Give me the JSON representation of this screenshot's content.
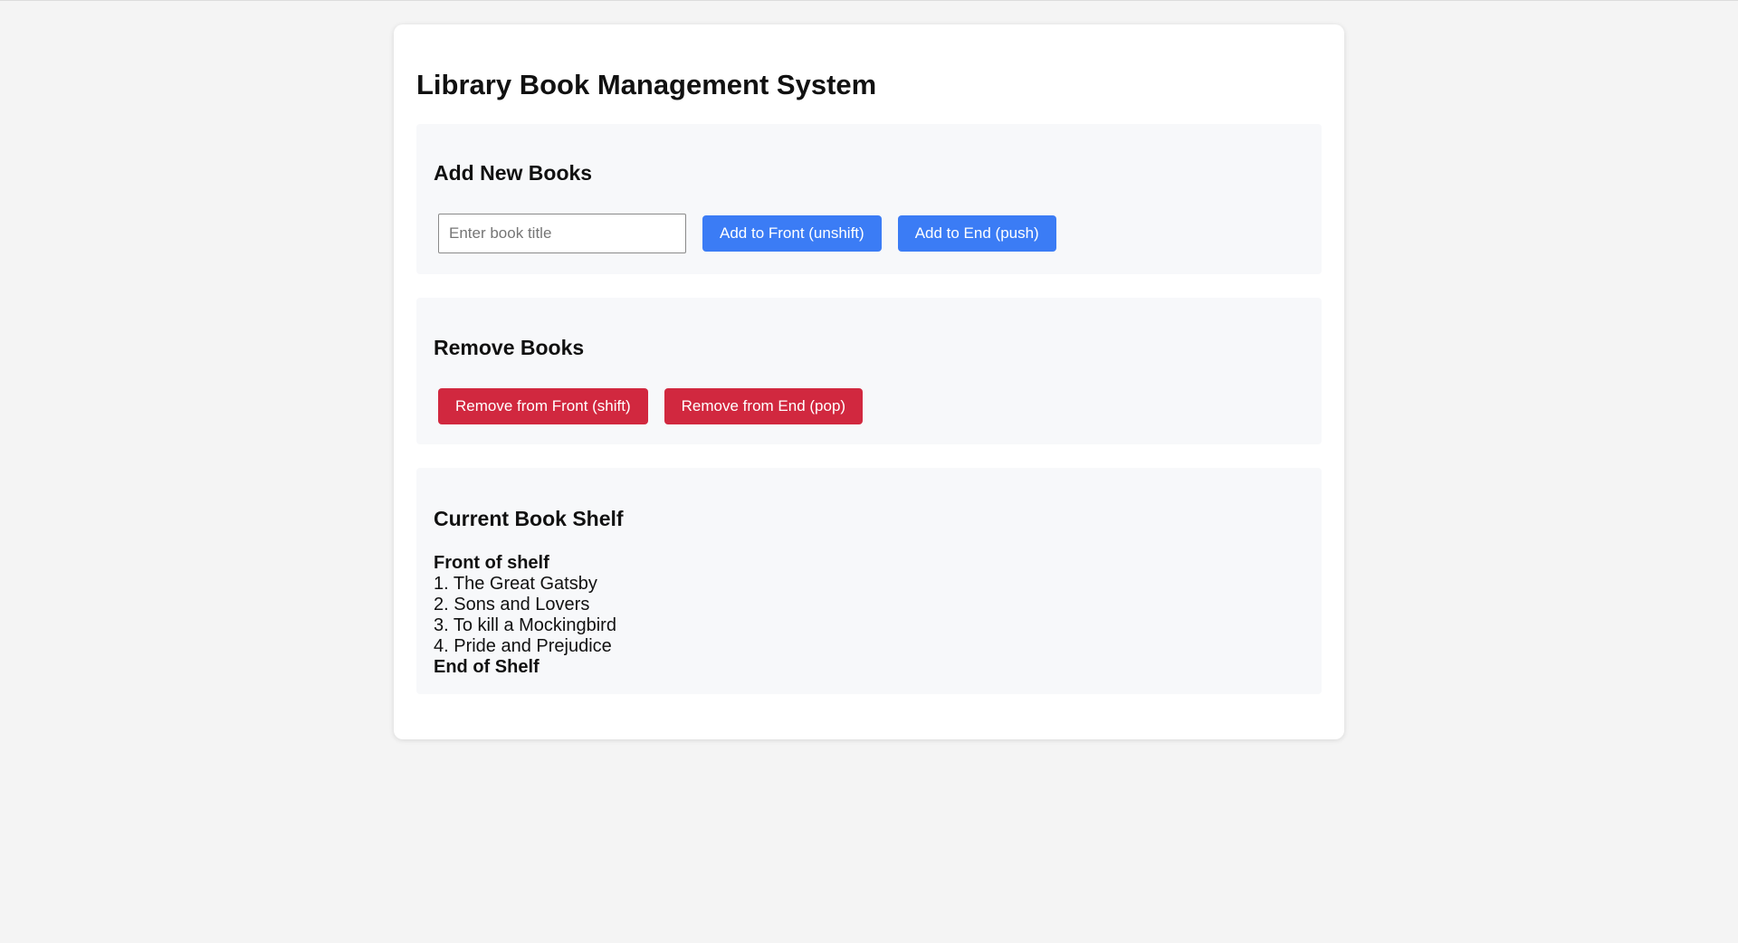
{
  "page": {
    "title": "Library Book Management System"
  },
  "add_section": {
    "heading": "Add New Books",
    "input_placeholder": "Enter book title",
    "input_value": "",
    "add_front_label": "Add to Front (unshift)",
    "add_end_label": "Add to End (push)"
  },
  "remove_section": {
    "heading": "Remove Books",
    "remove_front_label": "Remove from Front (shift)",
    "remove_end_label": "Remove from End (pop)"
  },
  "shelf_section": {
    "heading": "Current Book Shelf",
    "front_label": "Front of shelf",
    "books": [
      "1. The Great Gatsby",
      "2. Sons and Lovers",
      "3. To kill a Mockingbird",
      "4. Pride and Prejudice"
    ],
    "end_label": "End of Shelf"
  },
  "colors": {
    "page_background": "#f4f4f4",
    "section_background": "#f7f8fa",
    "add_button": "#3b7cf5",
    "remove_button": "#d1283f"
  }
}
